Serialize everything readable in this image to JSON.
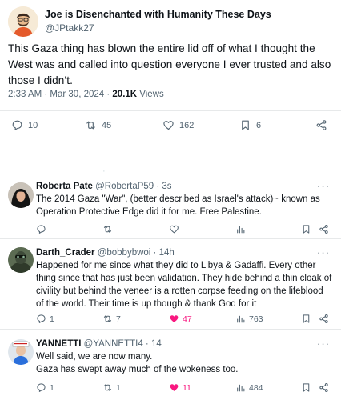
{
  "main_post": {
    "display_name": "Joe is Disenchanted with Humanity These Days",
    "handle": "@JPtakk27",
    "text": "This Gaza thing has blown the entire lid off of what I thought the West was and called into question everyone I ever trusted and also those I didn’t.",
    "time": "2:33 AM · Mar 30, 2024 · ",
    "views_count": "20.1K",
    "views_label": " Views",
    "stats": {
      "replies": "10",
      "reposts": "45",
      "likes": "162",
      "bookmarks": "6"
    }
  },
  "replies": [
    {
      "name": "Roberta Pate",
      "meta": " @RobertaP59 · 3s",
      "text": "The 2014 Gaza \"War\", (better described as Israel's attack)~ known as Operation Protective Edge did it for me. Free Palestine.",
      "stats": {
        "replies": "",
        "reposts": "",
        "likes": "",
        "views": ""
      },
      "liked": false
    },
    {
      "name": "Darth_Crader",
      "meta": " @bobbybwoi · 14h",
      "text": "Happened for me since what they did to Libya & Gadaffi. Every other thing since that has just been validation. They hide behind a thin cloak of civility but behind the veneer is a rotten corpse feeding on the lifeblood of the world. Their time is up though & thank God for it",
      "stats": {
        "replies": "1",
        "reposts": "7",
        "likes": "47",
        "views": "763"
      },
      "liked": true
    },
    {
      "name": "YANNETTI",
      "meta": " @YANNETTI4 · 14",
      "text": "Well said, we are now many.\nGaza has swept away much of the wokeness too.",
      "stats": {
        "replies": "1",
        "reposts": "1",
        "likes": "11",
        "views": "484"
      },
      "liked": true
    }
  ],
  "more_glyph": "···",
  "gap_glyph": "·",
  "colors": {
    "text": "#0f1419",
    "secondary": "#536471",
    "divider": "#e7e9ea",
    "like": "#f91880"
  },
  "icons": [
    "reply-icon",
    "repost-icon",
    "like-icon",
    "bookmark-icon",
    "share-icon",
    "views-icon",
    "more-icon"
  ]
}
